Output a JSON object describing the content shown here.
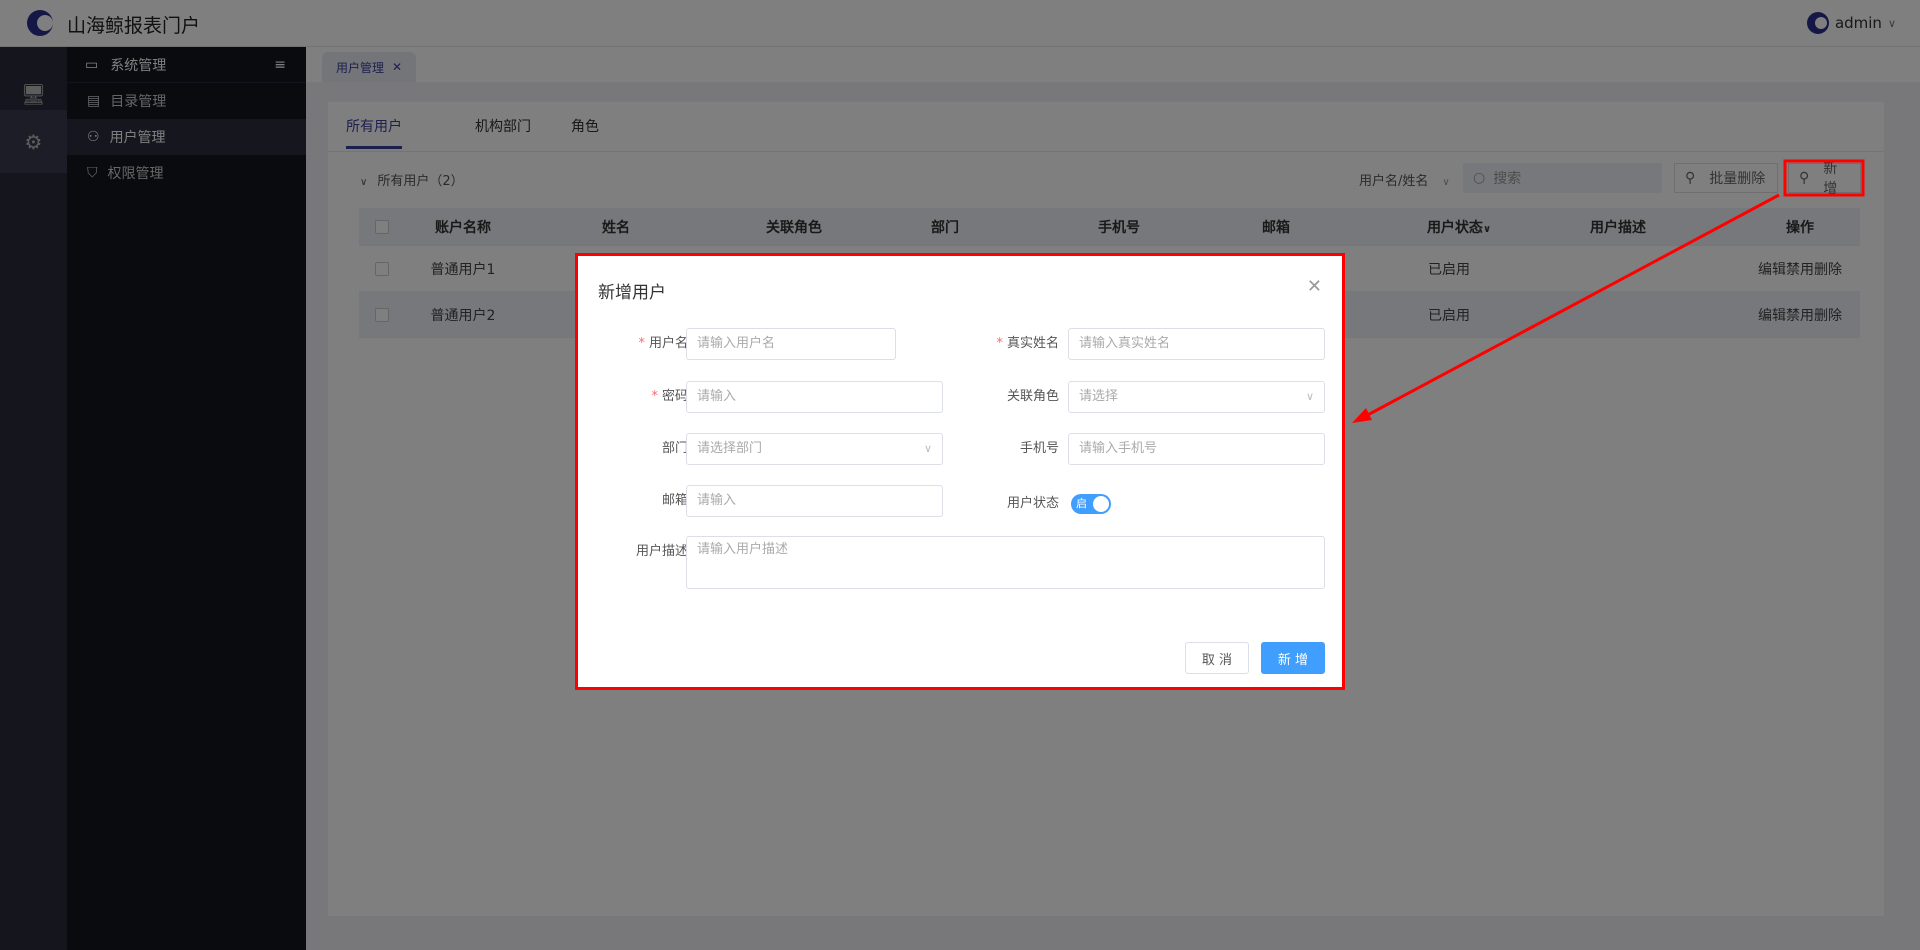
{
  "header": {
    "title": "山海鲸报表门户",
    "user": "admin"
  },
  "sidebar": {
    "section": "系统管理",
    "items": [
      {
        "label": "目录管理"
      },
      {
        "label": "用户管理"
      },
      {
        "label": "权限管理"
      }
    ]
  },
  "tabbar": {
    "tab": "用户管理"
  },
  "main": {
    "tabs": [
      "所有用户",
      "机构部门",
      "角色"
    ],
    "tree_label": "所有用户（2）",
    "filter_select": "用户名/姓名",
    "search_placeholder": "搜索",
    "batch_delete": "批量删除",
    "add": "新增",
    "columns": [
      "账户名称",
      "姓名",
      "关联角色",
      "部门",
      "手机号",
      "邮箱",
      "用户状态",
      "用户描述",
      "操作"
    ],
    "rows": [
      {
        "account": "普通用户1",
        "status": "已启用",
        "actions": [
          "编辑",
          "禁用",
          "删除"
        ]
      },
      {
        "account": "普通用户2",
        "status": "已启用",
        "actions": [
          "编辑",
          "禁用",
          "删除"
        ]
      }
    ]
  },
  "modal": {
    "title": "新增用户",
    "fields": {
      "username": {
        "label": "用户名",
        "placeholder": "请输入用户名"
      },
      "realname": {
        "label": "真实姓名",
        "placeholder": "请输入真实姓名"
      },
      "password": {
        "label": "密码",
        "placeholder": "请输入"
      },
      "role": {
        "label": "关联角色",
        "placeholder": "请选择"
      },
      "dept": {
        "label": "部门",
        "placeholder": "请选择部门"
      },
      "phone": {
        "label": "手机号",
        "placeholder": "请输入手机号"
      },
      "email": {
        "label": "邮箱",
        "placeholder": "请输入"
      },
      "status": {
        "label": "用户状态",
        "toggle_text": "启",
        "on": true
      },
      "desc": {
        "label": "用户描述",
        "placeholder": "请输入用户描述"
      }
    },
    "cancel": "取 消",
    "submit": "新 增"
  },
  "colors": {
    "accent": "#3b3f9e",
    "primary_button": "#409eff",
    "annotation": "#ff0000"
  }
}
